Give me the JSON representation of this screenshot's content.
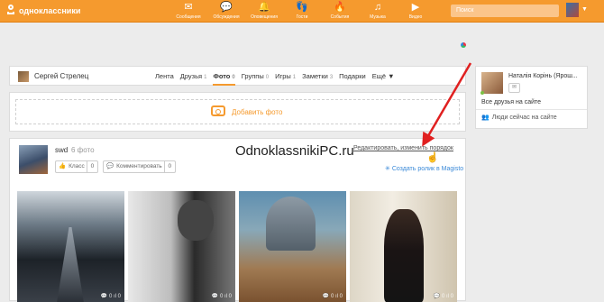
{
  "brand": {
    "name": "одноклассники"
  },
  "nav": [
    {
      "label": "Сообщения",
      "icon": "envelope-icon",
      "glyph": "✉"
    },
    {
      "label": "Обсуждения",
      "icon": "chat-icon",
      "glyph": "💬"
    },
    {
      "label": "Оповещения",
      "icon": "bell-icon",
      "glyph": "🔔"
    },
    {
      "label": "Гости",
      "icon": "footprints-icon",
      "glyph": "👣"
    },
    {
      "label": "События",
      "icon": "events-icon",
      "glyph": "🔥"
    },
    {
      "label": "Музыка",
      "icon": "music-icon",
      "glyph": "♫"
    },
    {
      "label": "Видео",
      "icon": "video-icon",
      "glyph": "▶"
    }
  ],
  "search": {
    "placeholder": "Поиск"
  },
  "profile": {
    "name": "Сергей Стрелец",
    "tabs": [
      {
        "label": "Лента",
        "count": ""
      },
      {
        "label": "Друзья",
        "count": "1"
      },
      {
        "label": "Фото",
        "count": "0"
      },
      {
        "label": "Группы",
        "count": "0"
      },
      {
        "label": "Игры",
        "count": "1"
      },
      {
        "label": "Заметки",
        "count": "3"
      },
      {
        "label": "Подарки",
        "count": ""
      },
      {
        "label": "Ещё ▼",
        "count": ""
      }
    ]
  },
  "add_photo": {
    "label": "Добавить фото"
  },
  "album": {
    "name": "swd",
    "count": "6 фото",
    "like_label": "Класс",
    "like_count": "0",
    "comment_label": "Комментировать",
    "comment_count": "0",
    "edit_link": "Редактировать, изменить порядок",
    "magisto_label": "Создать ролик в Magisto",
    "photo_meta": "💬 0   ıl 0"
  },
  "watermark": "OdnoklassnikiPC.ru",
  "sidebar": {
    "friend_name": "Наталія Корінь (Ярош...",
    "all_friends": "Все друзья на сайте",
    "people_online": "Люди сейчас на сайте"
  },
  "colors": {
    "accent": "#f59a2e",
    "link": "#3b8ad8",
    "arrow": "#e02020"
  }
}
